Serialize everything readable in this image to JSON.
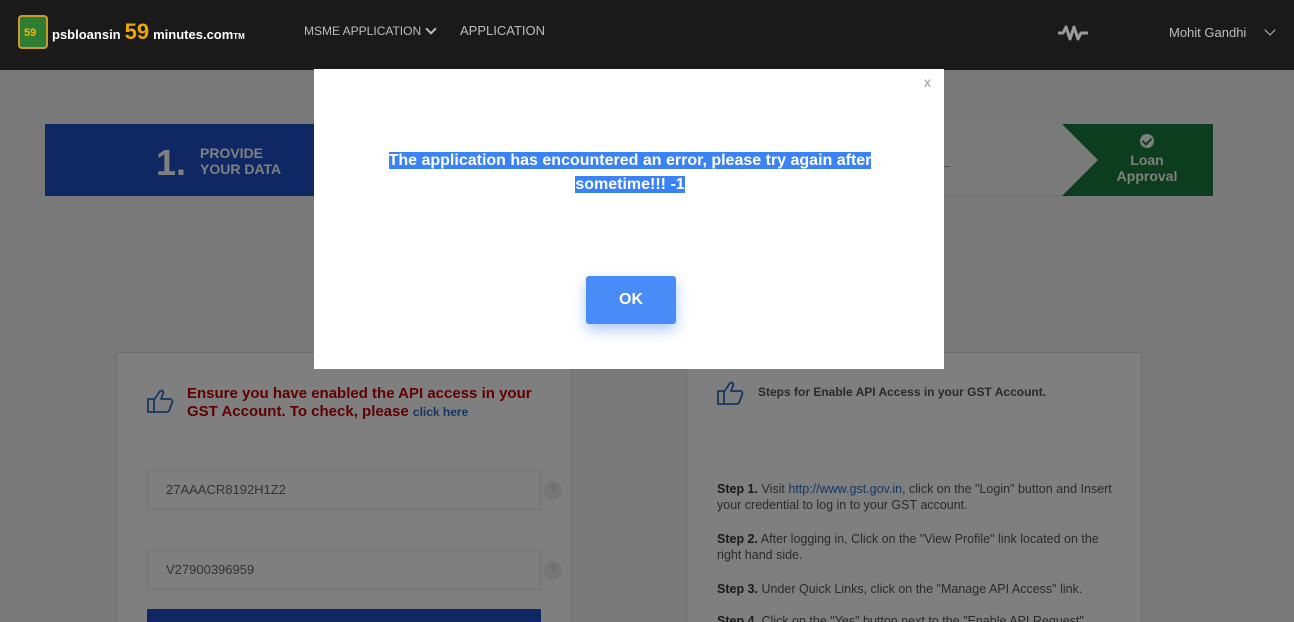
{
  "header": {
    "logo_text_left": "psbloansin",
    "logo_number": "59",
    "logo_text_right": "minutes.com",
    "logo_tm": "TM",
    "logo_badge": "59",
    "nav_msme": "MSME APPLICATION",
    "nav_application": "APPLICATION",
    "user_name": "Mohit Gandhi"
  },
  "stepper": {
    "step1_number": "1.",
    "step1_label_line1": "PROVIDE",
    "step1_label_line2": "YOUR DATA",
    "final_label_line1": "Loan",
    "final_label_line2": "Approval"
  },
  "form": {
    "notice_text": "Ensure you have enabled the API access in your GST Account. To check, please",
    "notice_link": "click here",
    "gstin_value": "27AAACR8192H1Z2",
    "username_value": "V27900396959",
    "help_glyph": "?"
  },
  "instructions": {
    "title": "Steps for Enable API Access in your GST Account.",
    "step1_label": "Step 1.",
    "step1_pre": "Visit",
    "step1_link": "http://www.gst.gov.in",
    "step1_post": ", click on the \"Login\" button and Insert your credential to log in to your GST account.",
    "step2_label": "Step 2.",
    "step2_text": "After logging in, Click on the \"View Profile\" link located on the right hand side.",
    "step3_label": "Step 3.",
    "step3_text": "Under Quick Links, click on the \"Manage API Access\" link.",
    "step4_label": "Step 4.",
    "step4_text": "Click on the \"Yes\" button next to the \"Enable API Request\""
  },
  "modal": {
    "close_label": "x",
    "message_line1": "The application has encountered an error, please try again after",
    "message_line2": "sometime!!! -1",
    "ok_label": "OK"
  },
  "colors": {
    "primary_blue": "#1e50c8",
    "success_green": "#1a7a3f",
    "ok_button": "#4a8cf7",
    "error_red": "#c00000"
  }
}
